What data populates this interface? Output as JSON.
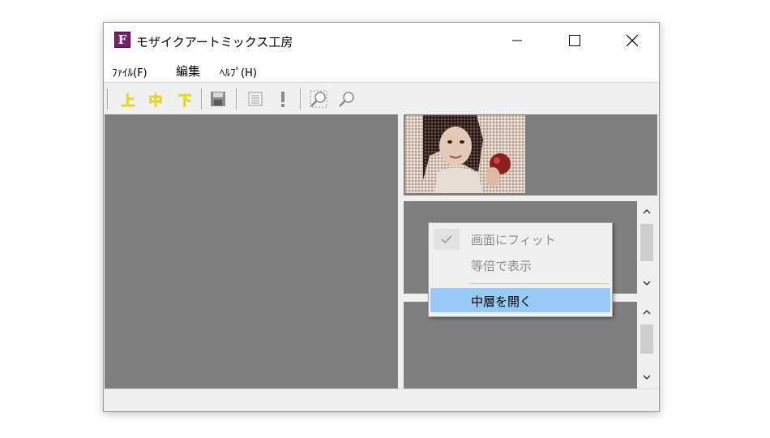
{
  "window": {
    "title": "モザイクアートミックス工房",
    "icon_letter": "F",
    "controls": [
      "minimize",
      "maximize",
      "close"
    ]
  },
  "menubar": {
    "items": [
      {
        "label": "ﾌｧｲﾙ(F)"
      },
      {
        "label": "編集"
      },
      {
        "label": "ﾍﾙﾌﾟ(H)"
      }
    ]
  },
  "toolbar": {
    "up_label": "上",
    "middle_label": "中",
    "down_label": "下",
    "icons": [
      "save-icon",
      "list-icon",
      "exclamation-icon",
      "zoom-fit-icon",
      "zoom-icon"
    ]
  },
  "context_menu": {
    "items": [
      {
        "label": "画面にフィット",
        "checked": true,
        "enabled": false
      },
      {
        "label": "等倍で表示",
        "checked": false,
        "enabled": false
      },
      {
        "label": "中層を開く",
        "checked": false,
        "enabled": true,
        "highlighted": true
      }
    ]
  },
  "colors": {
    "panel_gray": "#7f7f7f",
    "highlight_blue": "#99c9f7",
    "toolbar_yellow": "#f0e000",
    "icon_purple": "#7a1f6e"
  }
}
